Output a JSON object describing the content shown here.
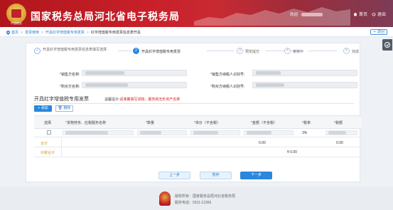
{
  "header": {
    "emblem_text": "中国税务",
    "title": "国家税务总局河北省电子税务局",
    "welcome": "欢迎",
    "nav": [
      {
        "label": "首页"
      },
      {
        "label": "退出"
      }
    ]
  },
  "breadcrumb": {
    "items": [
      "首页",
      "发票使用",
      "开具红字增值税专用发票",
      "红字增值税专用发票信息表开具"
    ],
    "back_label": "返回"
  },
  "steps": [
    {
      "num": "✓",
      "label": "开具红字增值税专用发票信息表填写选择",
      "state": "done"
    },
    {
      "num": "2",
      "label": "开具红字增值税专用发票",
      "state": "active"
    },
    {
      "num": "3",
      "label": "预览提交",
      "state": "todo"
    },
    {
      "num": "4",
      "label": "审核中",
      "state": "todo"
    },
    {
      "num": "5",
      "label": "完成",
      "state": "todo"
    }
  ],
  "form": {
    "seller_name_label": "销售方名称:",
    "seller_tax_label": "销售方纳税人识别号:",
    "buyer_name_label": "购买方名称:",
    "buyer_tax_label": "购买方纳税人识别号:"
  },
  "section": {
    "title": "开具红字增值税专用发票",
    "hint_prefix": "温馨提示:",
    "hint_warning": "请准确填写货物、服务和无形资产名称"
  },
  "toolbar": {
    "add_label": "添加",
    "delete_label": "删除"
  },
  "table": {
    "headers": [
      {
        "label": "选择",
        "required": false
      },
      {
        "label": "货物劳务、应税服务名称",
        "required": true
      },
      {
        "label": "数量",
        "required": true
      },
      {
        "label": "单价（不含税）",
        "required": true
      },
      {
        "label": "金额（不含税）",
        "required": true
      },
      {
        "label": "税率",
        "required": true
      },
      {
        "label": "税额",
        "required": true
      }
    ],
    "rows": [
      {
        "rate": "3%"
      }
    ],
    "total_label": "合计",
    "total_amount": "0.00",
    "total_tax": "0.00",
    "grand_total_label": "价税合计",
    "grand_total_value": "¥ 0.00"
  },
  "actions": {
    "prev_label": "上一步",
    "save_label": "暂存",
    "next_label": "下一步"
  },
  "footer": {
    "line1": "版权所有：国家税务总局河北省税务局",
    "line2": "服务电话：0311-12366"
  }
}
